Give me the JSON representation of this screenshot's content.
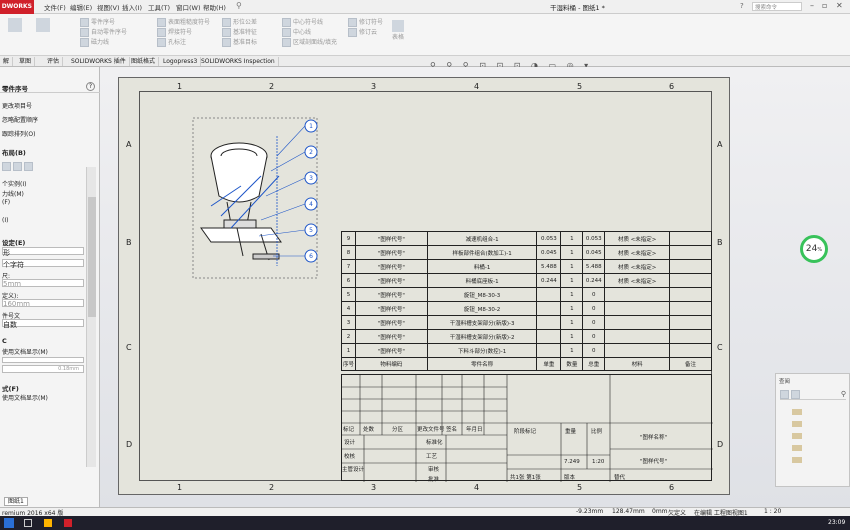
{
  "app": {
    "logo": "DWORKS",
    "title": "干湿料桶 - 图纸1 *",
    "search_placeholder": "搜索命令",
    "menus": [
      "文件(F)",
      "编辑(E)",
      "视图(V)",
      "插入(I)",
      "工具(T)",
      "窗口(W)",
      "帮助(H)"
    ]
  },
  "ribbon": {
    "groups": [
      [
        "模型项目",
        "拼写检验程序",
        "格式涂刷器"
      ],
      [
        "注释",
        "零件序号",
        "自动零件序号",
        "磁力线"
      ],
      [
        "表面粗糙度符号",
        "焊接符号",
        "孔标注"
      ],
      [
        "形位公差",
        "基准特征",
        "基准目标"
      ],
      [
        "中心符号线",
        "中心线",
        "区域剖面线/填充"
      ],
      [
        "修订符号",
        "修订云",
        "表格"
      ]
    ]
  },
  "tabs": [
    "解",
    "草图",
    "评估",
    "SOLIDWORKS 插件",
    "图纸格式",
    "Logopress3",
    "SOLIDWORKS Inspection"
  ],
  "left_panel": {
    "title": "零件序号",
    "help": "?",
    "items": [
      "更改项目号",
      "忽略配置顺序",
      "跟踪排列(O)",
      "布局(B)",
      "个实例(I)",
      "力线(M)",
      "(F)",
      "(I)",
      "设定(E)",
      "形",
      "个字符",
      "尺:",
      "5mm",
      "定义):",
      "160mm",
      "件号文",
      "自数",
      "C",
      "使用文档显示(M)",
      "0.18mm",
      "式(F)",
      "使用文档显示(M)"
    ],
    "bottom_tab": "图纸1"
  },
  "view_tools": "⚲ ⚲ ⚲ ⊡ ⊡ ⊡ ◑ ▭ ◎ ▾",
  "drawing": {
    "col_labels": [
      "1",
      "2",
      "3",
      "4",
      "5",
      "6"
    ],
    "row_labels": [
      "A",
      "B",
      "C",
      "D"
    ],
    "balloons": [
      "1",
      "2",
      "3",
      "4",
      "5",
      "6"
    ],
    "bom_rows": [
      {
        "no": "9",
        "code": "\"图样代号\"",
        "name": "减速机组合-1",
        "w1": "0.053",
        "q": "1",
        "w2": "0.053",
        "mat": "材质 <未指定>"
      },
      {
        "no": "8",
        "code": "\"图样代号\"",
        "name": "样板部件组合(数加工)-1",
        "w1": "0.045",
        "q": "1",
        "w2": "0.045",
        "mat": "材质 <未指定>"
      },
      {
        "no": "7",
        "code": "\"图样代号\"",
        "name": "料桶-1",
        "w1": "5.488",
        "q": "1",
        "w2": "5.488",
        "mat": "材质 <未指定>"
      },
      {
        "no": "6",
        "code": "\"图样代号\"",
        "name": "料桶底座板-1",
        "w1": "0.244",
        "q": "1",
        "w2": "0.244",
        "mat": "材质 <未指定>"
      },
      {
        "no": "5",
        "code": "\"图样代号\"",
        "name": "旋钮_M8-30-3",
        "w1": "",
        "q": "1",
        "w2": "0",
        "mat": ""
      },
      {
        "no": "4",
        "code": "\"图样代号\"",
        "name": "旋钮_M8-30-2",
        "w1": "",
        "q": "1",
        "w2": "0",
        "mat": ""
      },
      {
        "no": "3",
        "code": "\"图样代号\"",
        "name": "干湿料槽支架部分(新版)-3",
        "w1": "",
        "q": "1",
        "w2": "0",
        "mat": ""
      },
      {
        "no": "2",
        "code": "\"图样代号\"",
        "name": "干湿料槽支架部分(新版)-2",
        "w1": "",
        "q": "1",
        "w2": "0",
        "mat": ""
      },
      {
        "no": "1",
        "code": "\"图样代号\"",
        "name": "下料斗部分(数控)-1",
        "w1": "",
        "q": "1",
        "w2": "0",
        "mat": ""
      }
    ],
    "bom_header": [
      "序号",
      "物料编码",
      "零件名称",
      "单重",
      "数量",
      "总重",
      "材料",
      "备注"
    ],
    "title_block": {
      "row_labels": [
        "标记",
        "处数",
        "分区",
        "更改文件号",
        "签名",
        "年月日"
      ],
      "design": "设计",
      "standardize": "标准化",
      "check": "校核",
      "process": "工艺",
      "supervisor": "主管设计",
      "review": "审核",
      "approve": "批准",
      "stage_mark": "阶段标记",
      "weight": "重量",
      "scale": "比例",
      "weight_val": "7.249",
      "scale_val": "1:20",
      "drawing_name": "\"图样名称\"",
      "drawing_code": "\"图样代号\"",
      "sheets": "共1张  第1张",
      "version": "版本",
      "replace": "替代"
    }
  },
  "cpu": {
    "value": "24",
    "unit": "%"
  },
  "mini_panel": {
    "title": "查阅"
  },
  "status": {
    "app": "remium 2016 x64 版",
    "x": "-9.23mm",
    "y": "128.47mm",
    "z": "0mm",
    "state": "欠定义",
    "editing": "在编辑 工程图视图1",
    "scale": "1 : 20"
  },
  "taskbar": {
    "time": "23:09"
  }
}
